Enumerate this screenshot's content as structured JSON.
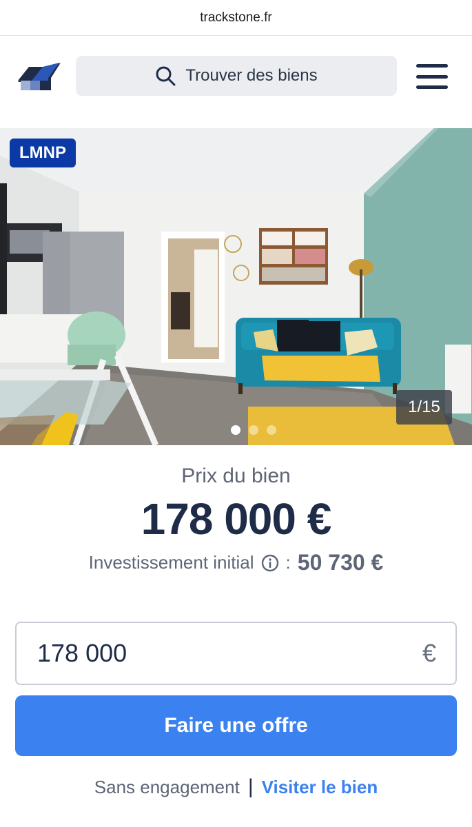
{
  "browser": {
    "url": "trackstone.fr"
  },
  "header": {
    "search_label": "Trouver des biens",
    "search_icon": "search-icon",
    "menu_icon": "hamburger-menu-icon",
    "logo_icon": "trackstone-logo-icon"
  },
  "listing": {
    "badge": "LMNP",
    "photo_counter": "1/15",
    "carousel_dots": 3,
    "carousel_active": 0
  },
  "pricing": {
    "price_label": "Prix du bien",
    "price": "178 000 €",
    "initial_label": "Investissement initial",
    "info_icon": "info-icon",
    "initial_separator": ":",
    "initial_value": "50 730 €"
  },
  "offer": {
    "amount_value": "178 000",
    "currency": "€",
    "submit_label": "Faire une offre"
  },
  "footer": {
    "note": "Sans engagement",
    "separator": "|",
    "visit_link": "Visiter le bien"
  },
  "colors": {
    "accent": "#3b82f0",
    "badge": "#0b39a6",
    "navy": "#1f2c48"
  }
}
